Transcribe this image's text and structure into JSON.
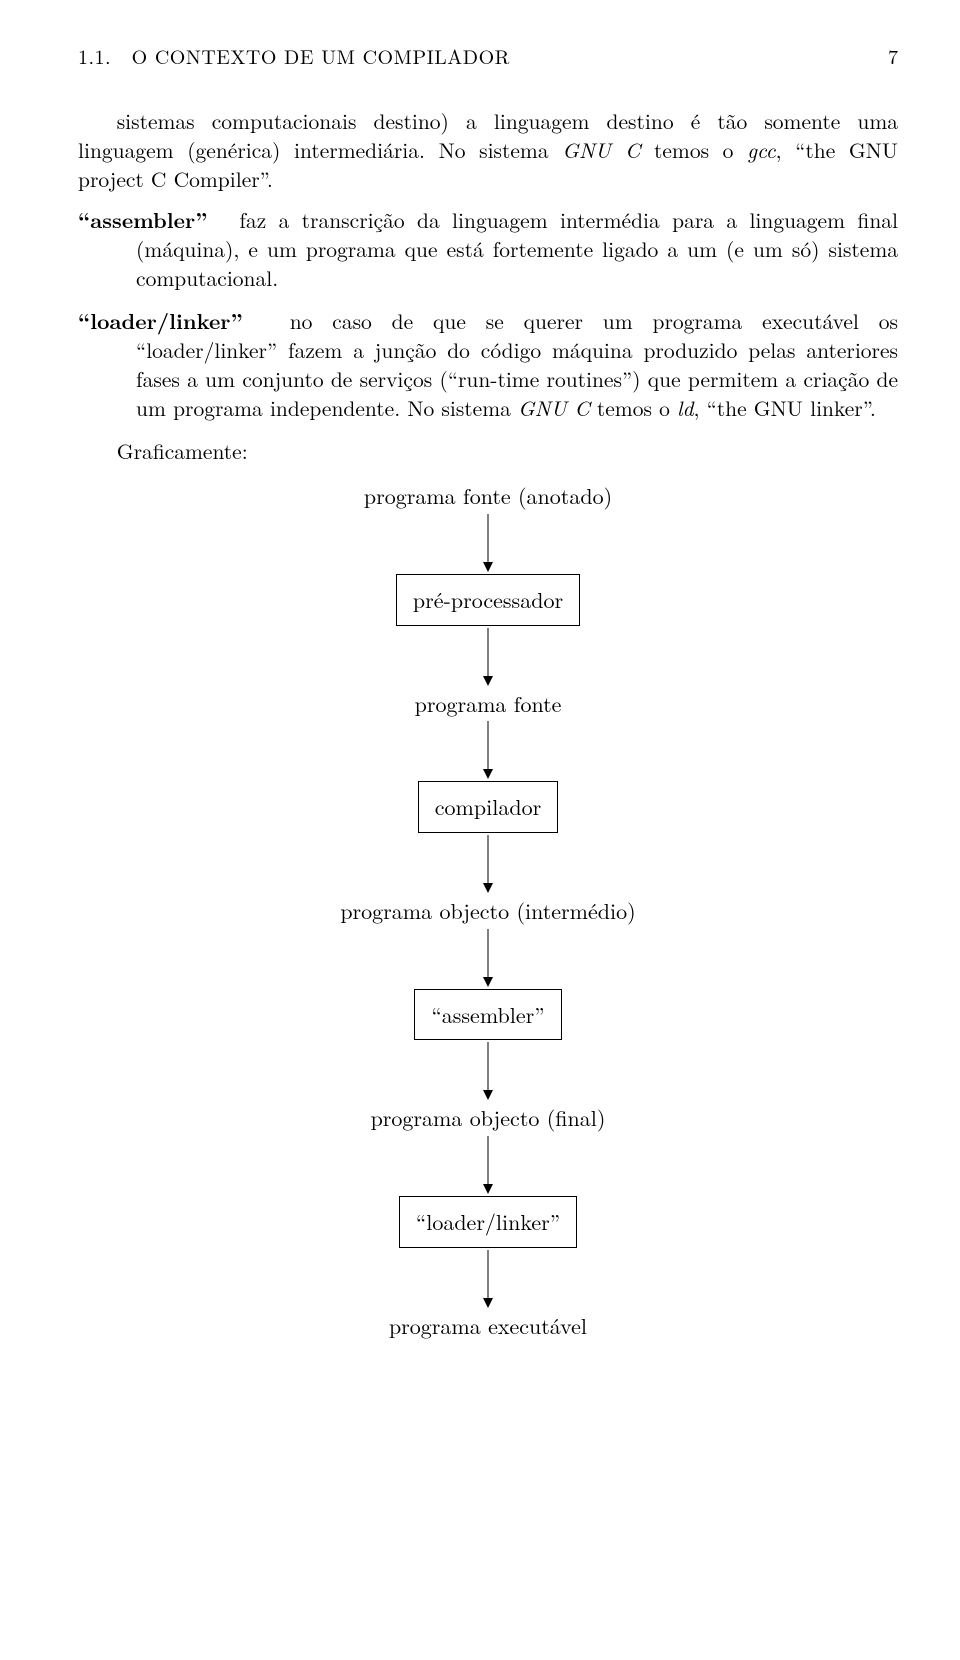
{
  "header": {
    "running": "1.1. O CONTEXTO DE UM COMPILADOR",
    "page": "7"
  },
  "paras": {
    "p1": "sistemas computacionais destino) a linguagem destino é tão somente uma linguagem (genérica) intermediária. No sistema ",
    "p1b": "GNU C",
    "p1c": " temos o ",
    "p1d": "gcc",
    "p1e": ", “the GNU project C Compiler”.",
    "assembler_lead": "assembler",
    "assembler_body": "faz a transcrição da linguagem intermédia para a linguagem final (máquina), e um programa que está fortemente ligado a um (e um só) sistema computacional.",
    "loader_lead": "loader/linker",
    "loader_b1": "no caso de que se querer um programa executável os “loader/linker” fazem a junção do código máquina produzido pelas anteriores fases a um conjunto de serviços (“run-time routines”) que permitem a criação de um programa independente. No sistema ",
    "loader_b2": "GNU C",
    "loader_b3": " temos o ",
    "loader_b4": "ld",
    "loader_b5": ", “the GNU linker”.",
    "graficamente": "Graficamente:"
  },
  "flow": {
    "n1": "programa fonte (anotado)",
    "b1": "pré-processador",
    "n2": "programa fonte",
    "b2": "compilador",
    "n3": "programa objecto (intermédio)",
    "b3": "“assembler”",
    "n4": "programa objecto (final)",
    "b4": "“loader/linker”",
    "n5": "programa executável"
  }
}
